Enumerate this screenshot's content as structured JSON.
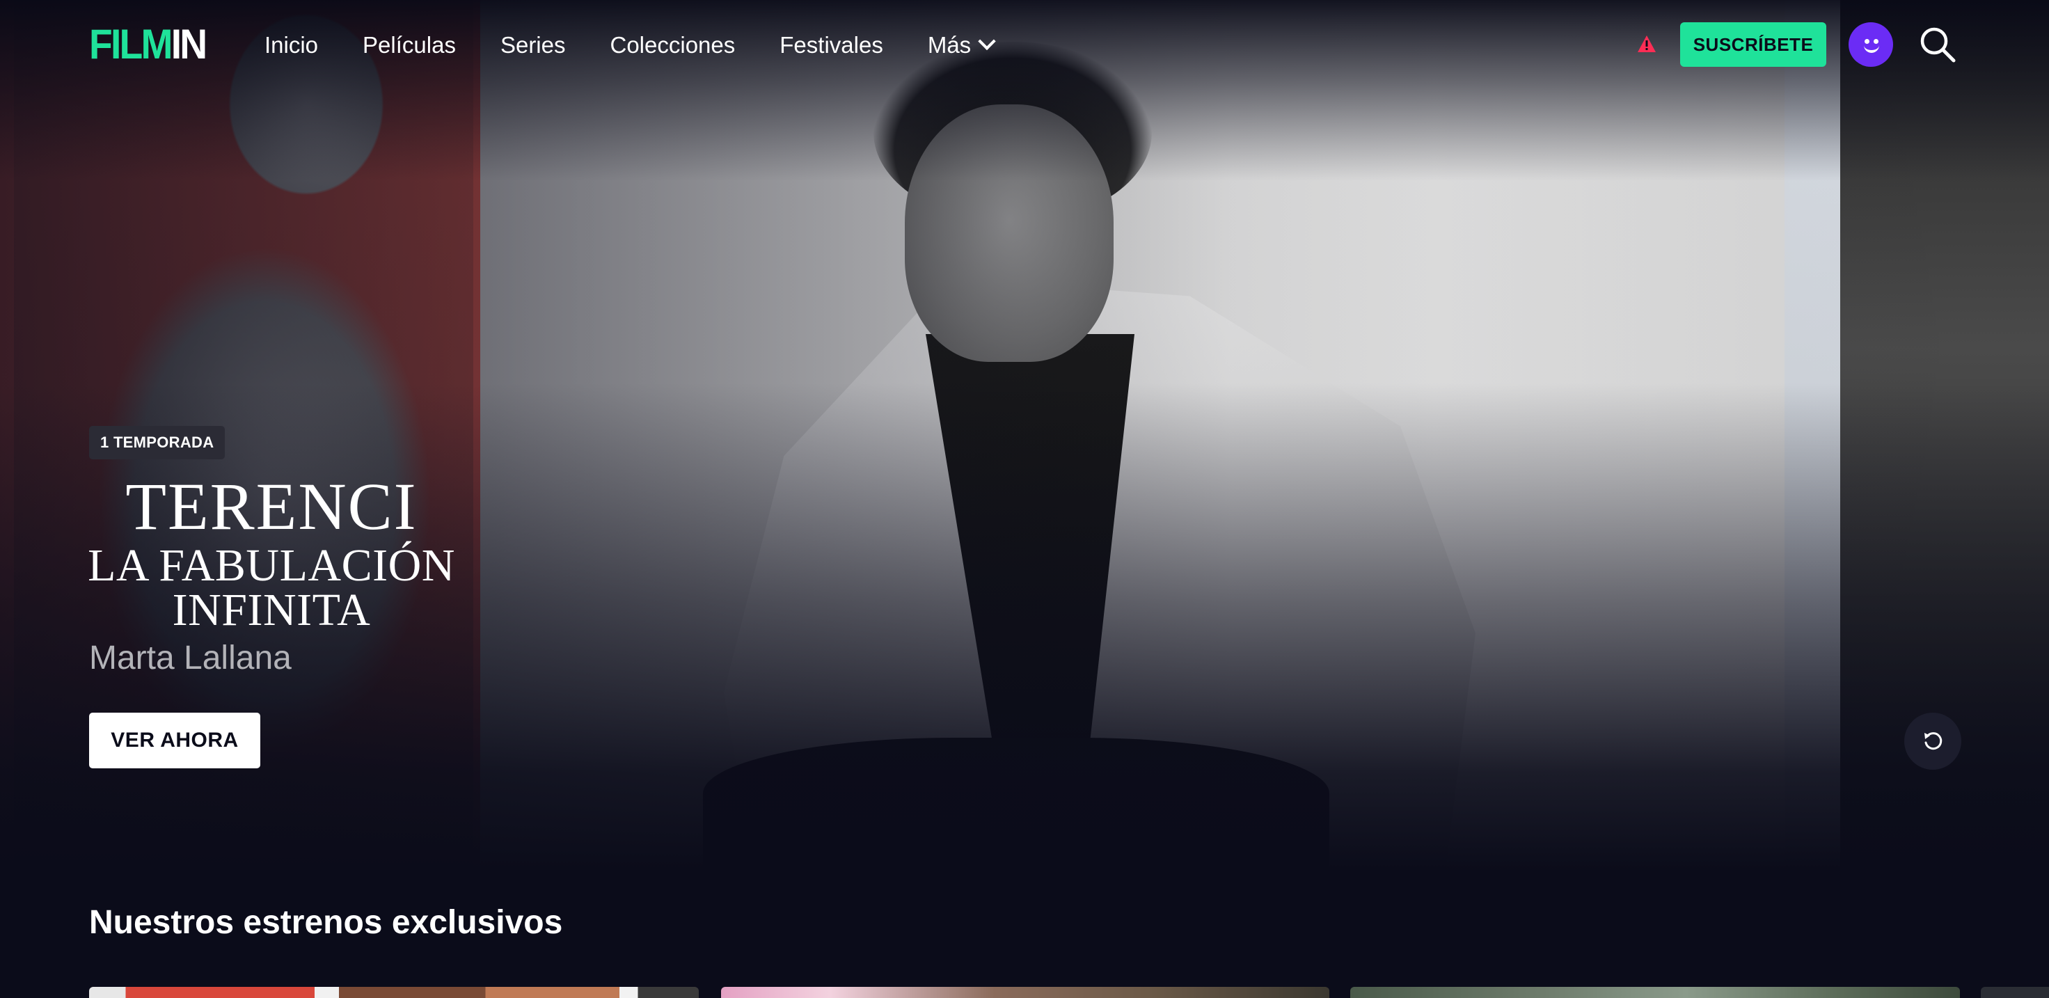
{
  "nav": {
    "logo": {
      "part1": "FILM",
      "part2": "IN"
    },
    "links": [
      {
        "label": "Inicio"
      },
      {
        "label": "Películas"
      },
      {
        "label": "Series"
      },
      {
        "label": "Colecciones"
      },
      {
        "label": "Festivales"
      },
      {
        "label": "Más"
      }
    ],
    "subscribe_label": "SUSCRÍBETE",
    "icons": {
      "alert": "warning-triangle-icon",
      "avatar": "smiley-avatar",
      "search": "search-icon"
    }
  },
  "hero": {
    "badge": "1 TEMPORADA",
    "title_line1": "TERENCI",
    "title_line2": "LA FABULACIÓN",
    "title_line3": "INFINITA",
    "director": "Marta Lallana",
    "cta_label": "VER AHORA",
    "replay_icon": "replay-icon"
  },
  "section": {
    "title": "Nuestros estrenos exclusivos"
  },
  "colors": {
    "brand_green": "#1fe29a",
    "alert_red": "#ff2d55",
    "avatar_purple": "#6b2cf5",
    "background": "#0b0c1a"
  }
}
